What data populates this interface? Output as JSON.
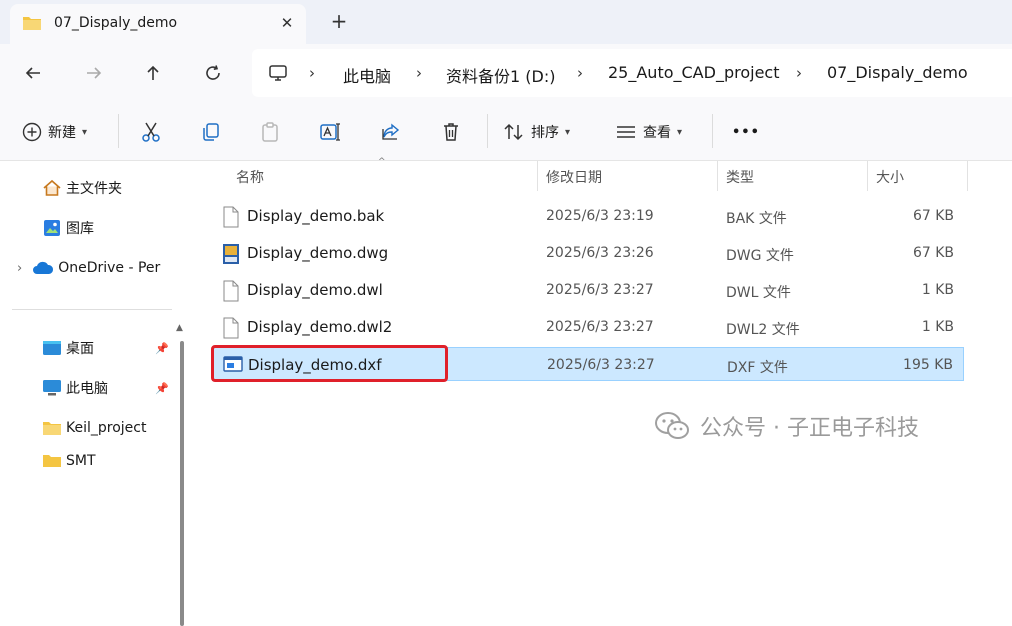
{
  "tab": {
    "title": "07_Dispaly_demo",
    "close": "✕",
    "new_tab": "+"
  },
  "nav": {
    "back": "←",
    "forward": "→",
    "up": "↑",
    "refresh": "↻"
  },
  "breadcrumb": [
    "此电脑",
    "资料备份1 (D:)",
    "25_Auto_CAD_project",
    "07_Dispaly_demo"
  ],
  "toolbar": {
    "new_label": "新建",
    "sort_label": "排序",
    "view_label": "查看",
    "more": "•••"
  },
  "sidebar": {
    "items": [
      {
        "label": "主文件夹"
      },
      {
        "label": "图库"
      },
      {
        "label": "OneDrive - Per"
      },
      {
        "label": "桌面"
      },
      {
        "label": "此电脑"
      },
      {
        "label": "Keil_project"
      },
      {
        "label": "SMT"
      }
    ]
  },
  "columns": {
    "name": "名称",
    "modified": "修改日期",
    "type": "类型",
    "size": "大小"
  },
  "files": [
    {
      "name": "Display_demo.bak",
      "modified": "2025/6/3 23:19",
      "type": "BAK 文件",
      "size": "67 KB",
      "icon": "blank-file-icon"
    },
    {
      "name": "Display_demo.dwg",
      "modified": "2025/6/3 23:26",
      "type": "DWG 文件",
      "size": "67 KB",
      "icon": "dwg-file-icon"
    },
    {
      "name": "Display_demo.dwl",
      "modified": "2025/6/3 23:27",
      "type": "DWL 文件",
      "size": "1 KB",
      "icon": "blank-file-icon"
    },
    {
      "name": "Display_demo.dwl2",
      "modified": "2025/6/3 23:27",
      "type": "DWL2 文件",
      "size": "1 KB",
      "icon": "blank-file-icon"
    },
    {
      "name": "Display_demo.dxf",
      "modified": "2025/6/3 23:27",
      "type": "DXF 文件",
      "size": "195 KB",
      "icon": "dxf-file-icon"
    }
  ],
  "selected_file": "Display_demo.dxf",
  "watermark": {
    "text": "公众号 · 子正电子科技"
  },
  "colors": {
    "selection": "#cce8ff",
    "highlight_box": "#e0202a",
    "folder": "#f4c542"
  }
}
